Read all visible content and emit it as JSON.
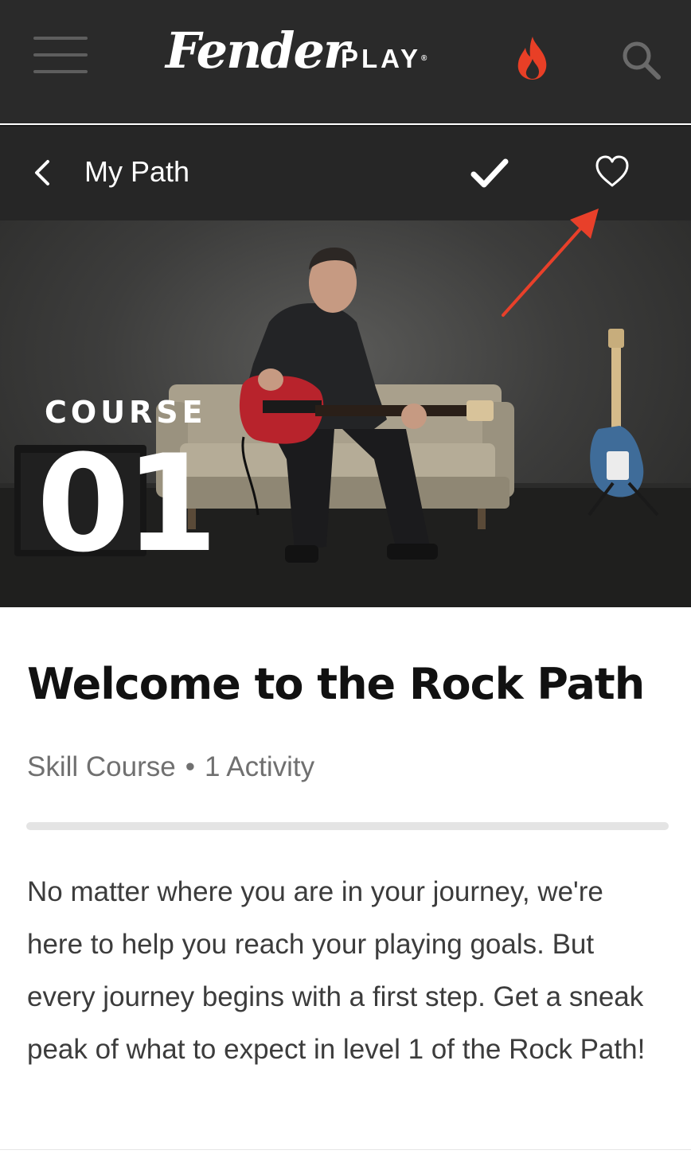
{
  "header": {
    "logo_script": "Fender",
    "logo_play": "PLAY",
    "logo_mark": "®",
    "icons": [
      "hamburger-menu-icon",
      "flame-icon",
      "search-icon"
    ],
    "accent_color": "#e83f26"
  },
  "subbar": {
    "back_label": "My Path",
    "icons": [
      "chevron-left-icon",
      "checkmark-icon",
      "heart-icon"
    ]
  },
  "hero": {
    "course_label": "COURSE",
    "course_number": "01"
  },
  "course": {
    "title": "Welcome to the Rock Path",
    "type": "Skill Course",
    "separator": "•",
    "activity_count": "1 Activity",
    "progress": 0,
    "description": "No matter where you are in your journey, we're here to help you reach your playing goals. But every journey begins with a first step. Get a sneak peak of what to expect in level 1 of the Rock Path!"
  },
  "annotation": {
    "color": "#e8402a",
    "target": "heart-icon"
  }
}
